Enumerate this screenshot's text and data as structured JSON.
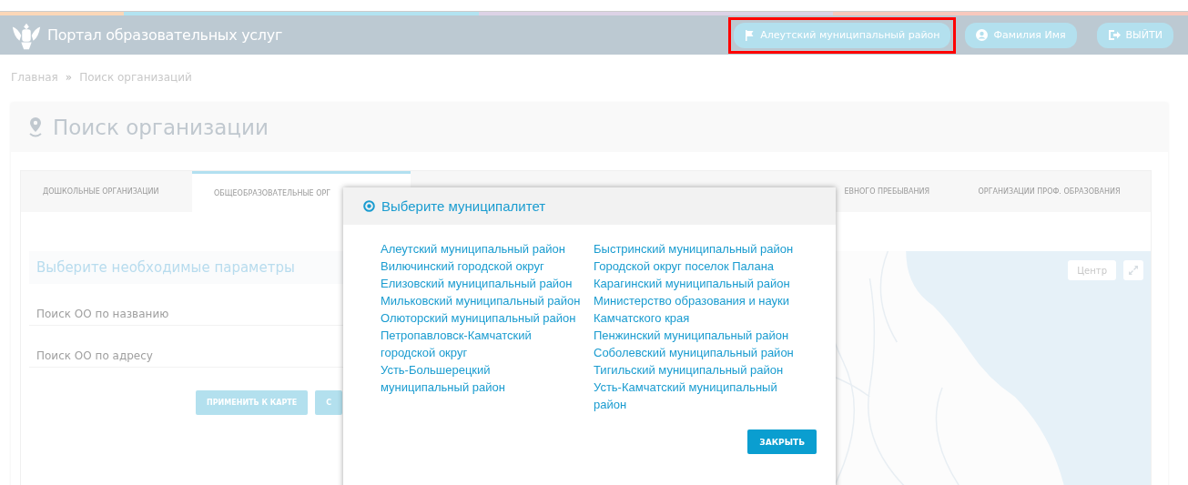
{
  "header": {
    "title": "Портал образовательных услуг",
    "buttons": [
      {
        "kind": "region",
        "label": "Алеутский муниципальный район",
        "highlighted": true
      },
      {
        "kind": "user",
        "label": "Фамилия Имя",
        "highlighted": false
      },
      {
        "kind": "logout",
        "label": "ВЫЙТИ",
        "highlighted": false
      }
    ]
  },
  "breadcrumb": [
    "Главная",
    "Поиск организаций"
  ],
  "breadcrumb_separator": "»",
  "page_title": "Поиск организации",
  "tabs": [
    {
      "label": "ДОШКОЛЬНЫЕ ОРГАНИЗАЦИИ",
      "selected": false
    },
    {
      "label": "ОБЩЕОБРАЗОВАТЕЛЬНЫЕ ОРГ",
      "selected": true
    },
    {
      "label": "ЕВНОГО ПРЕБЫВАНИЯ",
      "selected": false
    },
    {
      "label": "ОРГАНИЗАЦИИ ПРОФ. ОБРАЗОВАНИЯ",
      "selected": false
    }
  ],
  "filter": {
    "title": "Выберите необходимые параметры",
    "fields": [
      {
        "placeholder": "Поиск ОО по названию"
      },
      {
        "placeholder": "Поиск ОО по адресу"
      }
    ],
    "buttons": [
      "ПРИМЕНИТЬ К КАРТЕ",
      "С"
    ]
  },
  "map": {
    "center_label": "Центр"
  },
  "modal": {
    "title": "Выберите муниципалитет",
    "columns": [
      [
        "Алеутский муниципальный район",
        "Вилючинский городской округ",
        "Елизовский муниципальный район",
        "Мильковский муниципальный район",
        "Олюторский муниципальный район",
        "Петропавловск-Камчатский городской округ",
        "Усть-Большерецкий муниципальный район"
      ],
      [
        "Быстринский муниципальный район",
        "Городской округ поселок Палана",
        "Карагинский муниципальный район",
        "Министерство образования и науки Камчатского края",
        "Пенжинский муниципальный район",
        "Соболевский муниципальный район",
        "Тигильский муниципальный район",
        "Усть-Камчатский муниципальный район"
      ]
    ],
    "close_label": "ЗАКРЫТЬ"
  }
}
